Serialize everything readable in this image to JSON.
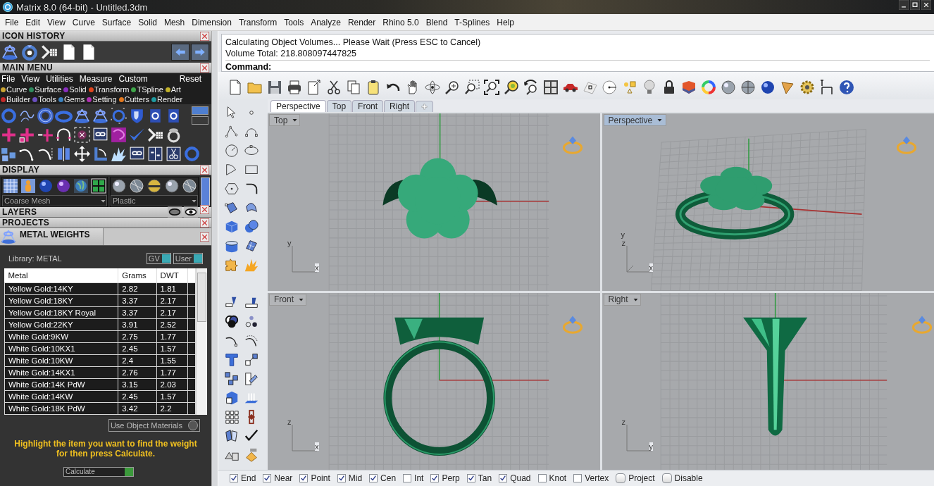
{
  "window": {
    "title": "Matrix 8.0 (64-bit) - Untitled.3dm"
  },
  "menu_bar": [
    "File",
    "Edit",
    "View",
    "Curve",
    "Surface",
    "Solid",
    "Mesh",
    "Dimension",
    "Transform",
    "Tools",
    "Analyze",
    "Render",
    "Rhino 5.0",
    "Blend",
    "T-Splines",
    "Help"
  ],
  "left_panel": {
    "icon_history": {
      "title": "ICON HISTORY"
    },
    "main_menu": {
      "title": "MAIN MENU",
      "menu": [
        "File",
        "View",
        "Utilities",
        "Measure",
        "Custom"
      ],
      "reset": "Reset",
      "categories": [
        {
          "label": "Curve",
          "color": "#c9a431"
        },
        {
          "label": "Surface",
          "color": "#2f8a5e"
        },
        {
          "label": "Solid",
          "color": "#8a2fc0"
        },
        {
          "label": "Transform",
          "color": "#e0461e"
        },
        {
          "label": "TSpline",
          "color": "#3fa64a"
        },
        {
          "label": "Art",
          "color": "#c2b22a"
        },
        {
          "label": "Builder",
          "color": "#c42a2a"
        },
        {
          "label": "Tools",
          "color": "#6a4fc0"
        },
        {
          "label": "Gems",
          "color": "#3a82c0"
        },
        {
          "label": "Setting",
          "color": "#b02fb0"
        },
        {
          "label": "Cutters",
          "color": "#e2781e"
        },
        {
          "label": "Render",
          "color": "#1f9aa0"
        }
      ]
    },
    "display": {
      "title": "DISPLAY",
      "mesh": "Coarse Mesh",
      "material": "Plastic"
    },
    "layers": {
      "title": "LAYERS"
    },
    "projects": {
      "title": "PROJECTS"
    },
    "metal_weights": {
      "title": "METAL WEIGHTS",
      "library": "Library: METAL",
      "toggles": [
        {
          "label": "GV",
          "on": true
        },
        {
          "label": "User",
          "on": true
        }
      ],
      "table": {
        "columns": [
          "Metal",
          "Grams",
          "DWT"
        ],
        "rows": [
          [
            "Yellow Gold:14KY",
            "2.82",
            "1.81"
          ],
          [
            "Yellow Gold:18KY",
            "3.37",
            "2.17"
          ],
          [
            "Yellow Gold:18KY Royal",
            "3.37",
            "2.17"
          ],
          [
            "Yellow Gold:22KY",
            "3.91",
            "2.52"
          ],
          [
            "White Gold:9KW",
            "2.75",
            "1.77"
          ],
          [
            "White Gold:10KX1",
            "2.45",
            "1.57"
          ],
          [
            "White Gold:10KW",
            "2.4",
            "1.55"
          ],
          [
            "White Gold:14KX1",
            "2.76",
            "1.77"
          ],
          [
            "White Gold:14K PdW",
            "3.15",
            "2.03"
          ],
          [
            "White Gold:14KW",
            "2.45",
            "1.57"
          ],
          [
            "White Gold:18K PdW",
            "3.42",
            "2.2"
          ]
        ]
      },
      "use_object_materials": {
        "label": "Use Object Materials",
        "checked": false
      },
      "hint": "Highlight the item you want to find the weight for then press Calculate.",
      "calculate_button": "Calculate"
    }
  },
  "command": {
    "history": [
      "Calculating Object Volumes... Please Wait (Press ESC to Cancel)",
      "Volume Total: 218.808097447825"
    ],
    "prompt": "Command:"
  },
  "viewport_tabs": [
    {
      "label": "Perspective",
      "selected": true
    },
    {
      "label": "Top",
      "selected": false
    },
    {
      "label": "Front",
      "selected": false
    },
    {
      "label": "Right",
      "selected": false
    }
  ],
  "viewports": [
    {
      "title": "Top",
      "kind": "top",
      "active": false,
      "axes": [
        {
          "label": "y",
          "kind": "up"
        },
        {
          "label": "x",
          "kind": "right"
        }
      ]
    },
    {
      "title": "Perspective",
      "kind": "perspective",
      "active": true,
      "axes": [
        {
          "label": "y",
          "kind": "diag"
        },
        {
          "label": "z",
          "kind": "up"
        },
        {
          "label": "x",
          "kind": "right"
        }
      ]
    },
    {
      "title": "Front",
      "kind": "front",
      "active": false,
      "axes": [
        {
          "label": "z",
          "kind": "up"
        },
        {
          "label": "x",
          "kind": "right"
        }
      ]
    },
    {
      "title": "Right",
      "kind": "right",
      "active": false,
      "axes": [
        {
          "label": "z",
          "kind": "up"
        },
        {
          "label": "y",
          "kind": "right"
        }
      ]
    }
  ],
  "osnaps": [
    {
      "label": "End",
      "kind": "checkbox",
      "checked": true
    },
    {
      "label": "Near",
      "kind": "checkbox",
      "checked": true
    },
    {
      "label": "Point",
      "kind": "checkbox",
      "checked": true
    },
    {
      "label": "Mid",
      "kind": "checkbox",
      "checked": true
    },
    {
      "label": "Cen",
      "kind": "checkbox",
      "checked": true
    },
    {
      "label": "Int",
      "kind": "checkbox",
      "checked": false
    },
    {
      "label": "Perp",
      "kind": "checkbox",
      "checked": true
    },
    {
      "label": "Tan",
      "kind": "checkbox",
      "checked": true
    },
    {
      "label": "Quad",
      "kind": "checkbox",
      "checked": true
    },
    {
      "label": "Knot",
      "kind": "checkbox",
      "checked": false
    },
    {
      "label": "Vertex",
      "kind": "checkbox",
      "checked": false
    },
    {
      "label": "Project",
      "kind": "toggle",
      "checked": false
    },
    {
      "label": "Disable",
      "kind": "toggle",
      "checked": false
    }
  ]
}
